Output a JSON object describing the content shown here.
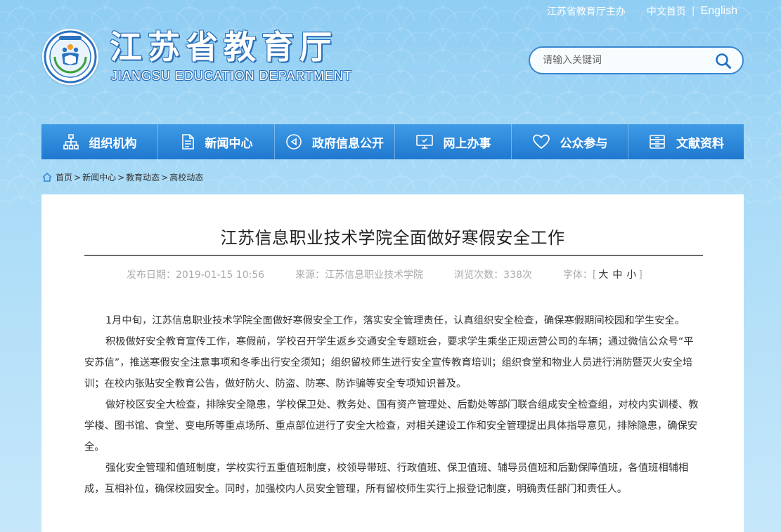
{
  "top_links": {
    "host": "江苏省教育厅主办",
    "home_cn": "中文首页",
    "separator": "|",
    "english": "English"
  },
  "logo": {
    "title": "江苏省教育厅",
    "subtitle": "JIANGSU EDUCATION DEPARTMENT",
    "emblem_icon": "education-emblem-icon"
  },
  "search": {
    "placeholder": "请输入关键词",
    "icon": "search-icon"
  },
  "nav": [
    {
      "label": "组织机构",
      "icon": "org-chart-icon"
    },
    {
      "label": "新闻中心",
      "icon": "document-icon"
    },
    {
      "label": "政府信息公开",
      "icon": "announce-icon"
    },
    {
      "label": "网上办事",
      "icon": "monitor-icon"
    },
    {
      "label": "公众参与",
      "icon": "heart-icon"
    },
    {
      "label": "文献资料",
      "icon": "archive-icon"
    }
  ],
  "breadcrumb": {
    "icon": "home-icon",
    "items": [
      "首页",
      "新闻中心",
      "教育动态",
      "高校动态"
    ],
    "sep": ">"
  },
  "article": {
    "title": "江苏信息职业技术学院全面做好寒假安全工作",
    "meta": {
      "date_label": "发布日期：",
      "date": "2019-01-15 10:56",
      "source_label": "来源：",
      "source": "江苏信息职业技术学院",
      "views_label": "浏览次数：",
      "views": "338次",
      "font_label": "字体：",
      "font_open": "[",
      "font_large": "大",
      "font_medium": "中",
      "font_small": "小",
      "font_close": "]"
    },
    "paragraphs": [
      "1月中旬，江苏信息职业技术学院全面做好寒假安全工作，落实安全管理责任，认真组织安全检查，确保寒假期间校园和学生安全。",
      "积极做好安全教育宣传工作，寒假前，学校召开学生返乡交通安全专题班会，要求学生乘坐正规运营公司的车辆；通过微信公众号“平安苏信”，推送寒假安全注意事项和冬季出行安全须知；组织留校师生进行安全宣传教育培训；组织食堂和物业人员进行消防暨灭火安全培训；在校内张贴安全教育公告，做好防火、防盗、防寒、防诈骗等安全专项知识普及。",
      "做好校区安全大检查，排除安全隐患，学校保卫处、教务处、国有资产管理处、后勤处等部门联合组成安全检查组，对校内实训楼、教学楼、图书馆、食堂、变电所等重点场所、重点部位进行了安全大检查，对相关建设工作和安全管理提出具体指导意见，排除隐患，确保安全。",
      "强化安全管理和值班制度，学校实行五重值班制度，校领导带班、行政值班、保卫值班、辅导员值班和后勤保障值班，各值班相辅相成，互相补位，确保校园安全。同时，加强校内人员安全管理，所有留校师生实行上报登记制度，明确责任部门和责任人。"
    ]
  },
  "colors": {
    "nav_top": "#3f9be6",
    "nav_bottom": "#1f78cf",
    "bg_sky": "#a9dbf7",
    "logo_stroke": "#2a6fb8"
  }
}
